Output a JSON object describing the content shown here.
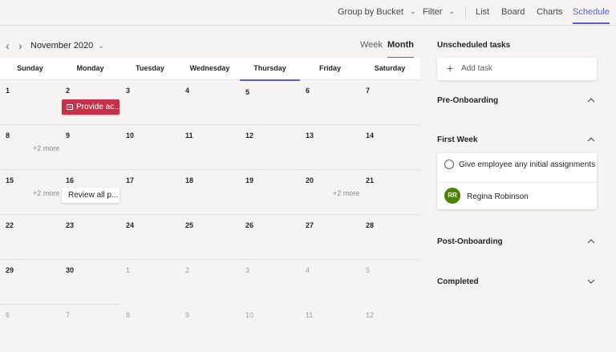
{
  "toolbar": {
    "group_by": "Group by Bucket",
    "filter": "Filter",
    "tabs": [
      "List",
      "Board",
      "Charts",
      "Schedule"
    ],
    "active_tab": "Schedule",
    "accent_color": "#5b5fc7"
  },
  "calendar": {
    "month_label": "November 2020",
    "view_week": "Week",
    "view_month": "Month",
    "weekdays": [
      "Sunday",
      "Monday",
      "Tuesday",
      "Wednesday",
      "Thursday",
      "Friday",
      "Saturday"
    ],
    "highlighted_weekday": "Thursday",
    "weeks": [
      [
        "1",
        "2",
        "3",
        "4",
        "5",
        "6",
        "7"
      ],
      [
        "8",
        "9",
        "10",
        "11",
        "12",
        "13",
        "14"
      ],
      [
        "15",
        "16",
        "17",
        "18",
        "19",
        "20",
        "21"
      ],
      [
        "22",
        "23",
        "24",
        "25",
        "26",
        "27",
        "28"
      ],
      [
        "29",
        "30",
        "1",
        "2",
        "3",
        "4",
        "5"
      ],
      [
        "6",
        "7",
        "8",
        "9",
        "10",
        "11",
        "12"
      ]
    ],
    "more_label": "+2 more",
    "event_red": "Provide ac...",
    "event_white": "Review all p...",
    "event_red_color": "#c4314b"
  },
  "panel": {
    "unscheduled_title": "Unscheduled tasks",
    "add_task": "Add task",
    "buckets": {
      "pre": "Pre-Onboarding",
      "first": "First Week",
      "post": "Post-Onboarding",
      "completed": "Completed"
    },
    "task": {
      "title": "Give employee any initial assignments",
      "assignee_initials": "RR",
      "assignee_name": "Regina Robinson",
      "avatar_color": "#498205"
    }
  }
}
